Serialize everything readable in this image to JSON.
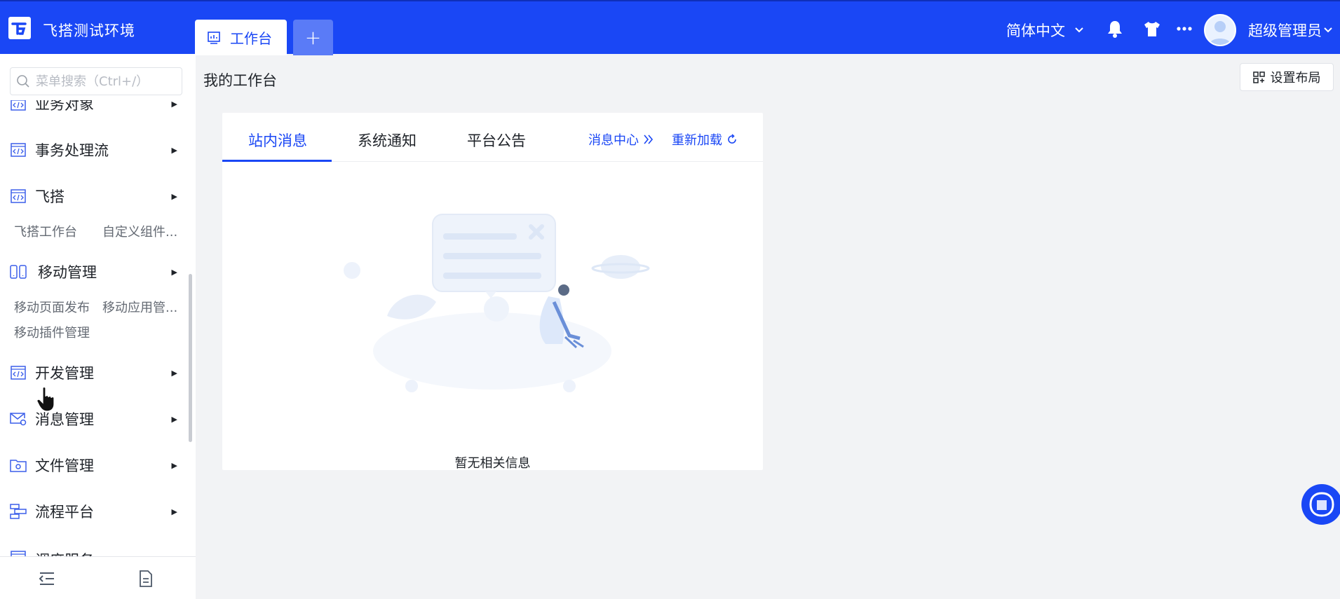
{
  "header": {
    "app_title": "飞搭测试环境",
    "active_tab": "工作台",
    "add_tab": "+",
    "language": "简体中文",
    "user_name": "超级管理员",
    "brand_color": "#1a47f5"
  },
  "sidebar": {
    "search_placeholder": "菜单搜索（Ctrl+/）",
    "groups": [
      {
        "label": "业务对象",
        "icon": "code-window-icon"
      },
      {
        "label": "事务处理流",
        "icon": "code-window-icon"
      },
      {
        "label": "飞搭",
        "icon": "code-window-icon",
        "children": [
          "飞搭工作台",
          "自定义组件..."
        ]
      },
      {
        "label": "移动管理",
        "icon": "mobile-icon",
        "children": [
          "移动页面发布",
          "移动应用管...",
          "移动插件管理"
        ]
      },
      {
        "label": "开发管理",
        "icon": "code-window-icon"
      },
      {
        "label": "消息管理",
        "icon": "mail-gear-icon"
      },
      {
        "label": "文件管理",
        "icon": "folder-gear-icon"
      },
      {
        "label": "流程平台",
        "icon": "flow-icon"
      },
      {
        "label": "调度服务",
        "icon": "code-window-icon"
      }
    ]
  },
  "main": {
    "page_title": "我的工作台",
    "layout_button": "设置布局",
    "card": {
      "tabs": [
        "站内消息",
        "系统通知",
        "平台公告"
      ],
      "active_tab_index": 0,
      "message_center": "消息中心",
      "reload": "重新加载",
      "empty_text": "暂无相关信息"
    }
  }
}
